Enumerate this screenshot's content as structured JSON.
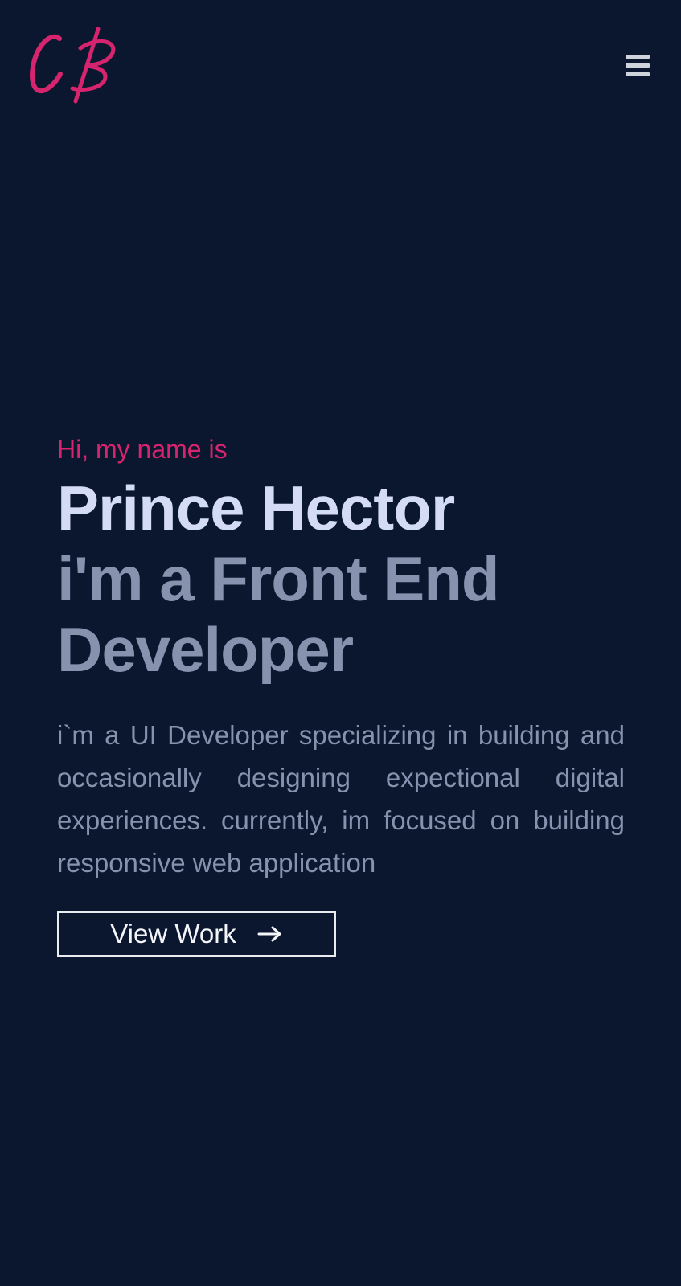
{
  "header": {
    "logo_text": "CB",
    "logo_color": "#d6246e",
    "menu_icon": "hamburger-menu-icon"
  },
  "hero": {
    "greeting": "Hi, my name is",
    "name": "Prince Hector",
    "role_line1": "i'm a Front End",
    "role_line2": "Developer",
    "bio": "i`m a UI Developer specializing in building and occasionally designing expectional digital experiences. currently, im focused on building responsive web application",
    "cta_label": "View Work",
    "cta_icon": "arrow-right-icon"
  },
  "colors": {
    "background": "#0b172e",
    "accent": "#d6246e",
    "name": "#d3dcf4",
    "muted_text": "#8792ae",
    "button_border": "#e9ebf0"
  }
}
